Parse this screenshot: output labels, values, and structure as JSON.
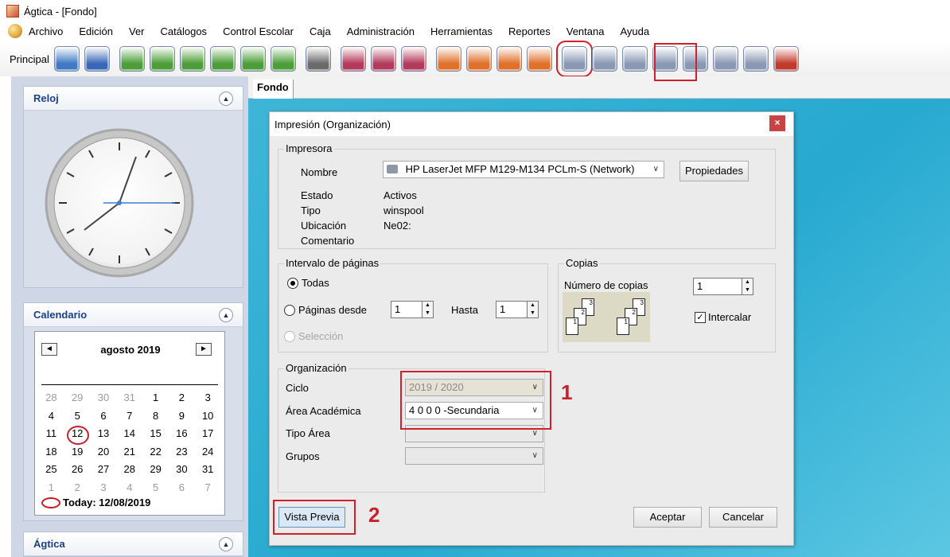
{
  "window": {
    "title": "Ágtica - [Fondo]"
  },
  "menu": {
    "items": [
      {
        "label": "Archivo"
      },
      {
        "label": "Edición"
      },
      {
        "label": "Ver"
      },
      {
        "label": "Catálogos"
      },
      {
        "label": "Control Escolar"
      },
      {
        "label": "Caja"
      },
      {
        "label": "Administración"
      },
      {
        "label": "Herramientas"
      },
      {
        "label": "Reportes"
      },
      {
        "label": "Ventana"
      },
      {
        "label": "Ayuda"
      }
    ]
  },
  "toolbar": {
    "label": "Principal",
    "buttons": [
      {
        "icon": "database-icon",
        "color": "#3f79c4"
      },
      {
        "icon": "desktop-icon",
        "color": "#3a68b8"
      },
      {
        "icon": "pen-icon",
        "color": "#4d9e3a"
      },
      {
        "icon": "group-icon",
        "color": "#4d9e3a"
      },
      {
        "icon": "users-icon",
        "color": "#4d9e3a"
      },
      {
        "icon": "id-card-icon",
        "color": "#4d9e3a"
      },
      {
        "icon": "clock-icon",
        "color": "#4d9e3a"
      },
      {
        "icon": "signature-icon",
        "color": "#4d9e3a"
      },
      {
        "icon": "calculator-icon",
        "color": "#6a6a6a"
      },
      {
        "icon": "people-icon",
        "color": "#b23a5a"
      },
      {
        "icon": "teachers-icon",
        "color": "#b23a5a"
      },
      {
        "icon": "id-badge-icon",
        "color": "#b23a5a"
      },
      {
        "icon": "chart-icon",
        "color": "#e0702a"
      },
      {
        "icon": "notes-icon",
        "color": "#e0702a"
      },
      {
        "icon": "shapes-icon",
        "color": "#e0702a"
      },
      {
        "icon": "books-icon",
        "color": "#e0702a"
      },
      {
        "icon": "print-org-icon",
        "color": "#8a98b4",
        "highlighted": true
      },
      {
        "icon": "print-icon",
        "color": "#8a98b4"
      },
      {
        "icon": "print-icon",
        "color": "#8a98b4"
      },
      {
        "icon": "print-icon",
        "color": "#8a98b4"
      },
      {
        "icon": "report-icon",
        "color": "#8a98b4"
      },
      {
        "icon": "print-icon",
        "color": "#8a98b4"
      },
      {
        "icon": "report-print-icon",
        "color": "#8a98b4"
      },
      {
        "icon": "exit-icon",
        "color": "#c0392b"
      }
    ]
  },
  "sidebar": {
    "clock": {
      "title": "Reloj"
    },
    "calendar": {
      "title": "Calendario",
      "month": "agosto 2019",
      "weeks": [
        [
          "28",
          "29",
          "30",
          "31",
          "1",
          "2",
          "3"
        ],
        [
          "4",
          "5",
          "6",
          "7",
          "8",
          "9",
          "10"
        ],
        [
          "11",
          "12",
          "13",
          "14",
          "15",
          "16",
          "17"
        ],
        [
          "18",
          "19",
          "20",
          "21",
          "22",
          "23",
          "24"
        ],
        [
          "25",
          "26",
          "27",
          "28",
          "29",
          "30",
          "31"
        ],
        [
          "1",
          "2",
          "3",
          "4",
          "5",
          "6",
          "7"
        ]
      ],
      "today_label": "Today: 12/08/2019"
    },
    "agtica": {
      "title": "Ágtica"
    }
  },
  "tab": {
    "label": "Fondo"
  },
  "dialog": {
    "title": "Impresión (Organización)",
    "close": "×",
    "printer": {
      "group": "Impresora",
      "name_label": "Nombre",
      "name_value": "HP LaserJet MFP M129-M134 PCLm-S (Network)",
      "properties": "Propiedades",
      "status_label": "Estado",
      "status_value": "Activos",
      "type_label": "Tipo",
      "type_value": "winspool",
      "location_label": "Ubicación",
      "location_value": "Ne02:",
      "comment_label": "Comentario"
    },
    "range": {
      "group": "Intervalo de páginas",
      "all": "Todas",
      "pages_from": "Páginas desde",
      "from_value": "1",
      "to_label": "Hasta",
      "to_value": "1",
      "selection": "Selección"
    },
    "copies": {
      "group": "Copias",
      "count_label": "Número de copias",
      "count_value": "1",
      "collate": "Intercalar",
      "collate_checked": true
    },
    "org": {
      "group": "Organización",
      "cycle_label": "Ciclo",
      "cycle_value": "2019 / 2020",
      "area_label": "Área Académica",
      "area_value": "4 0 0 0 -Secundaria",
      "area_type_label": "Tipo Área",
      "groups_label": "Grupos"
    },
    "preview": "Vista Previa",
    "ok": "Aceptar",
    "cancel": "Cancelar"
  },
  "annotations": {
    "first": "1",
    "second": "2"
  }
}
